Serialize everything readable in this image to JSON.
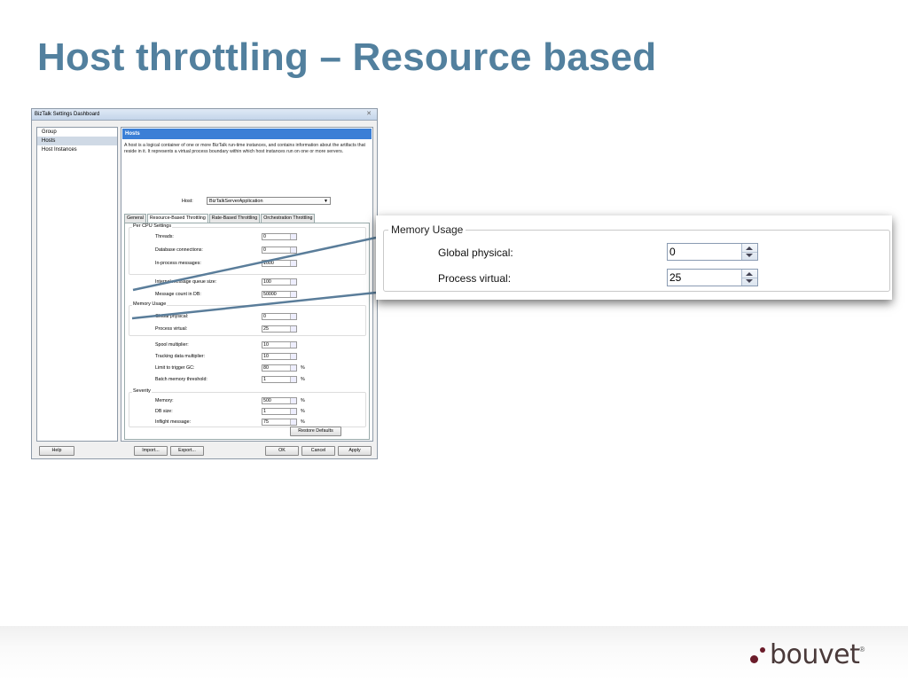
{
  "slide": {
    "title": "Host throttling – Resource based"
  },
  "dialog": {
    "title": "BizTalk Settings Dashboard",
    "close_glyph": "✕",
    "nav_items": [
      "Group",
      "Hosts",
      "Host Instances"
    ],
    "selected_nav": "Hosts",
    "section_header": "Hosts",
    "description": "A host is a logical container of one or more BizTalk run-time instances, and contains information about the artifacts that reside in it. It represents a virtual process boundary within which host instances run on one or more servers.",
    "host_label": "Host:",
    "host_value": "BizTalkServerApplication",
    "tabs": [
      "General",
      "Resource-Based Throttling",
      "Rate-Based Throttling",
      "Orchestration Throttling"
    ],
    "active_tab": "Resource-Based Throttling",
    "per_cpu": {
      "title": "Per CPU Settings",
      "threads_label": "Threads:",
      "threads_value": "0",
      "db_label": "Database connections:",
      "db_value": "0",
      "inproc_label": "In-process messages:",
      "inproc_value": "1000"
    },
    "queue_label": "Internal message queue size:",
    "queue_value": "100",
    "msgcount_label": "Message count in DB:",
    "msgcount_value": "50000",
    "memory": {
      "title": "Memory Usage",
      "global_label": "Global physical:",
      "global_value": "0",
      "process_label": "Process virtual:",
      "process_value": "25"
    },
    "spool_label": "Spool multiplier:",
    "spool_value": "10",
    "tracking_label": "Tracking data multiplier:",
    "tracking_value": "10",
    "gc_label": "Limit to trigger GC:",
    "gc_value": "80",
    "gc_unit": "%",
    "batch_label": "Batch memory threshold:",
    "batch_value": "1",
    "batch_unit": "%",
    "severity": {
      "title": "Severity",
      "memory_label": "Memory:",
      "memory_value": "500",
      "memory_unit": "%",
      "dbsize_label": "DB size:",
      "dbsize_value": "1",
      "dbsize_unit": "%",
      "inflight_label": "Inflight message:",
      "inflight_value": "75",
      "inflight_unit": "%"
    },
    "restore_defaults": "Restore Defaults",
    "buttons": {
      "help": "Help",
      "import": "Import...",
      "export": "Export...",
      "ok": "OK",
      "cancel": "Cancel",
      "apply": "Apply"
    }
  },
  "callout": {
    "title": "Memory Usage",
    "global_label": "Global physical:",
    "global_value": "0",
    "process_label": "Process virtual:",
    "process_value": "25"
  },
  "logo": {
    "text": "bouvet",
    "reg": "®"
  },
  "colors": {
    "title": "#52809e",
    "header_blue": "#3b7fd6",
    "connector": "#5a7d9a",
    "logo": "#6b1c2a"
  }
}
